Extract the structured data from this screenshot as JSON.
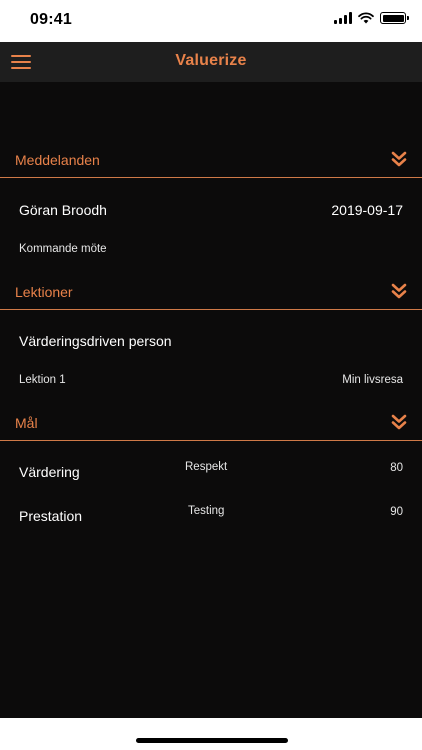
{
  "status_bar": {
    "time": "09:41"
  },
  "app": {
    "title": "Valuerize"
  },
  "messages": {
    "header": "Meddelanden",
    "sender": "Göran Broodh",
    "date": "2019-09-17",
    "subject": "Kommande möte"
  },
  "lessons": {
    "header": "Lektioner",
    "title": "Värderingsdriven person",
    "lesson": "Lektion 1",
    "subtitle": "Min livsresa"
  },
  "goals": {
    "header": "Mål",
    "items": [
      {
        "name": "Värdering",
        "value_label": "Respekt",
        "score": "80"
      },
      {
        "name": "Prestation",
        "value_label": "Testing",
        "score": "90"
      }
    ]
  },
  "colors": {
    "accent": "#e8824a",
    "background": "#0c0b0b",
    "nav": "#1e1e1e"
  },
  "icons": {
    "menu": "hamburger-menu-icon",
    "expand": "double-chevron-down-icon"
  }
}
